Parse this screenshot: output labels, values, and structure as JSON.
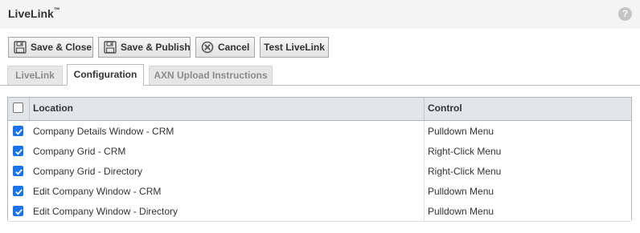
{
  "window": {
    "title": "LiveLink",
    "trademark": "™",
    "help_icon": "?"
  },
  "toolbar": {
    "save_close": "Save & Close",
    "save_publish": "Save & Publish",
    "cancel": "Cancel",
    "test_livelink": "Test LiveLink"
  },
  "tabs": [
    {
      "label": "LiveLink",
      "active": false
    },
    {
      "label": "Configuration",
      "active": true
    },
    {
      "label": "AXN Upload Instructions",
      "active": false
    }
  ],
  "grid": {
    "columns": {
      "location": "Location",
      "control": "Control"
    },
    "select_all_checked": false,
    "rows": [
      {
        "location": "Company Details Window - CRM",
        "control": "Pulldown Menu",
        "checked": true
      },
      {
        "location": "Company Grid - CRM",
        "control": "Right-Click Menu",
        "checked": true
      },
      {
        "location": "Company Grid - Directory",
        "control": "Right-Click Menu",
        "checked": true
      },
      {
        "location": "Edit Company Window - CRM",
        "control": "Pulldown Menu",
        "checked": true
      },
      {
        "location": "Edit Company Window - Directory",
        "control": "Pulldown Menu",
        "checked": true
      }
    ]
  },
  "colors": {
    "checkbox_accent": "#1a73e8",
    "header_bg": "#e3e6e8",
    "titlebar_bg": "#f4f4f4"
  },
  "icons": {
    "save": "floppy-disk-icon",
    "cancel": "cancel-circle-icon",
    "help": "help-icon"
  }
}
